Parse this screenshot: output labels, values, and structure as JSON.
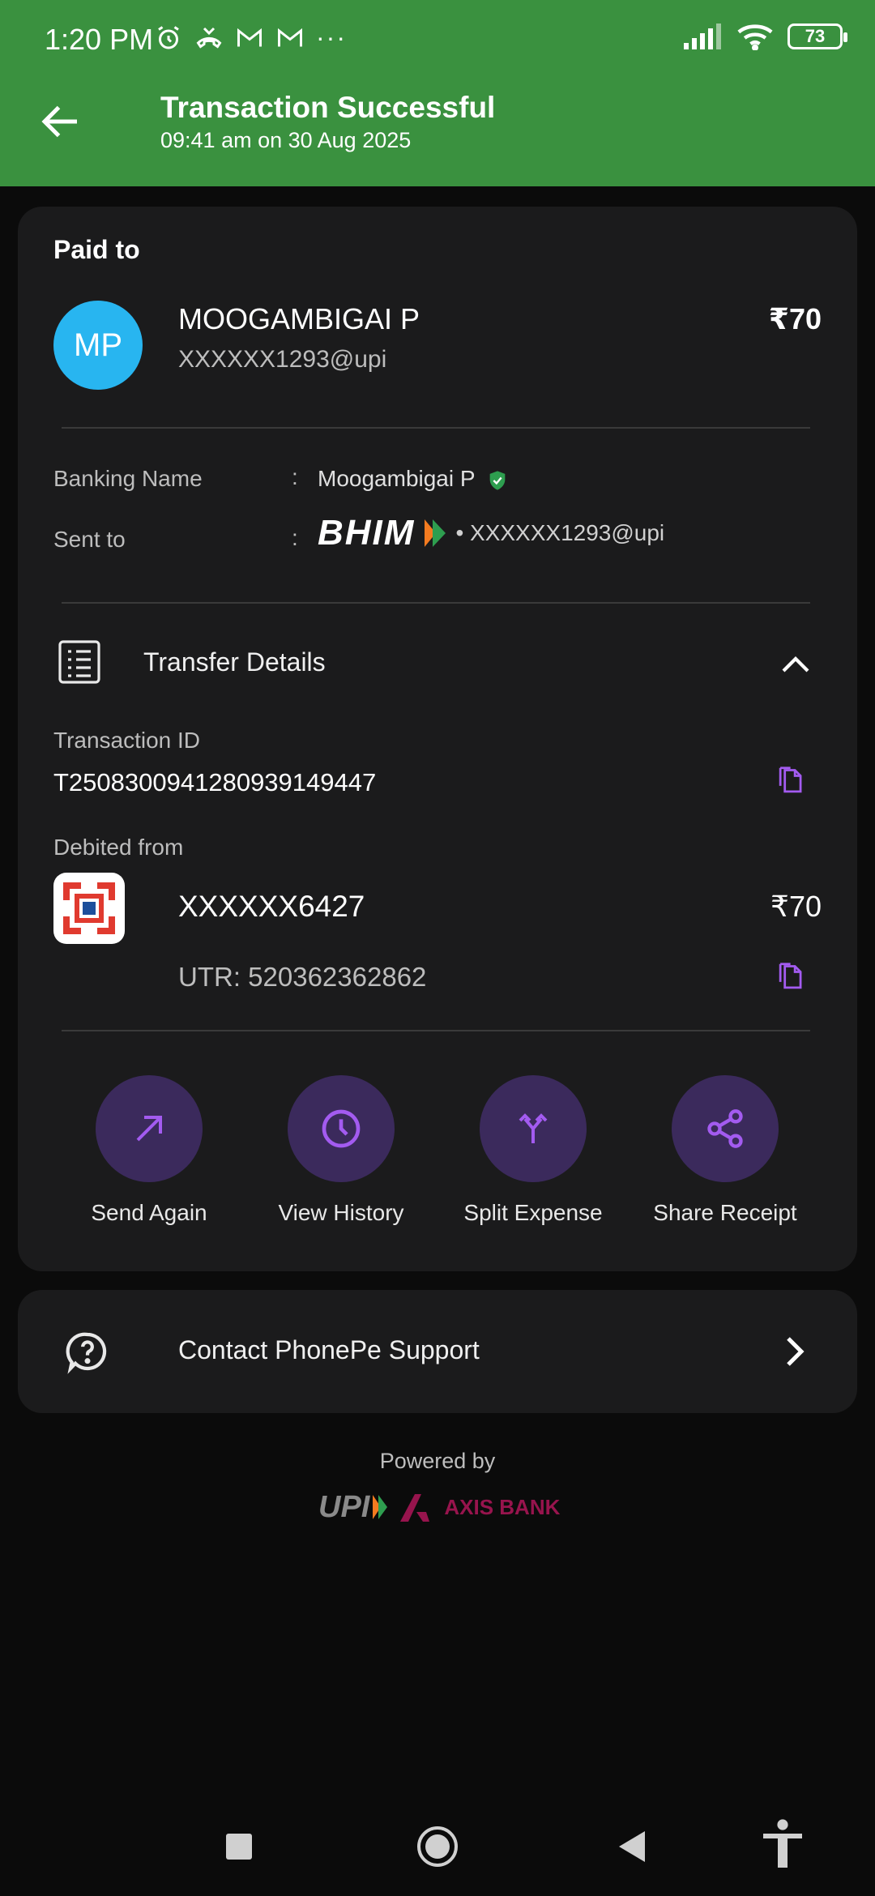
{
  "status_bar": {
    "time": "1:20 PM",
    "battery": "73"
  },
  "header": {
    "title": "Transaction Successful",
    "subtitle": "09:41 am on 30 Aug 2025"
  },
  "payee": {
    "section_label": "Paid to",
    "initials": "MP",
    "name": "MOOGAMBIGAI P",
    "upi_id": "XXXXXX1293@upi",
    "amount": "₹70"
  },
  "details": {
    "banking_name_label": "Banking Name",
    "banking_name_value": "Moogambigai P",
    "sent_to_label": "Sent to",
    "sent_to_app": "BHIM",
    "sent_to_value": "• XXXXXX1293@upi",
    "colon": ":"
  },
  "transfer": {
    "title": "Transfer Details",
    "txn_id_label": "Transaction ID",
    "txn_id_value": "T2508300941280939149447",
    "debited_label": "Debited from",
    "account": "XXXXXX6427",
    "amount": "₹70",
    "utr": "UTR: 520362362862"
  },
  "actions": [
    {
      "label": "Send Again",
      "icon": "arrow-up-right-icon"
    },
    {
      "label": "View History",
      "icon": "clock-icon"
    },
    {
      "label": "Split Expense",
      "icon": "split-icon"
    },
    {
      "label": "Share Receipt",
      "icon": "share-icon"
    }
  ],
  "support": {
    "label": "Contact PhonePe Support"
  },
  "footer": {
    "powered_by": "Powered by",
    "upi_logo": "UPI",
    "bank_name": "AXIS BANK"
  },
  "colors": {
    "header_green": "#3a913f",
    "accent_purple": "#a35bf0",
    "avatar_blue": "#28b5f0"
  }
}
